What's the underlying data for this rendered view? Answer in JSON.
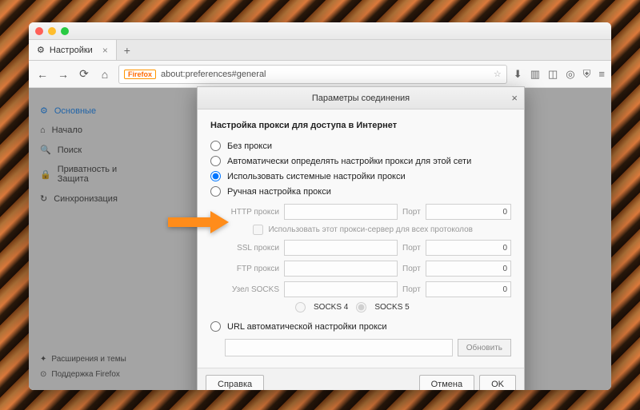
{
  "tab": {
    "title": "Настройки"
  },
  "urlbar": {
    "brand": "Firefox",
    "url": "about:preferences#general"
  },
  "sidebar": {
    "items": [
      {
        "icon": "gear",
        "label": "Основные",
        "active": true
      },
      {
        "icon": "home",
        "label": "Начало"
      },
      {
        "icon": "search",
        "label": "Поиск"
      },
      {
        "icon": "lock",
        "label": "Приватность и Защита"
      },
      {
        "icon": "sync",
        "label": "Синхронизация"
      }
    ],
    "bottom": [
      {
        "icon": "puzzle",
        "label": "Расширения и темы"
      },
      {
        "icon": "help",
        "label": "Поддержка Firefox"
      }
    ]
  },
  "modal": {
    "title": "Параметры соединения",
    "heading": "Настройка прокси для доступа в Интернет",
    "options": {
      "none": "Без прокси",
      "auto": "Автоматически определять настройки прокси для этой сети",
      "system": "Использовать системные настройки прокси",
      "manual": "Ручная настройка прокси",
      "url": "URL автоматической настройки прокси"
    },
    "selected": "system",
    "proxy": {
      "http_label": "HTTP прокси",
      "ssl_label": "SSL прокси",
      "ftp_label": "FTP прокси",
      "socks_label": "Узел SOCKS",
      "port_label": "Порт",
      "port_value": "0",
      "useall_label": "Использовать этот прокси-сервер для всех протоколов",
      "socks4": "SOCKS 4",
      "socks5": "SOCKS 5",
      "socks_selected": "5"
    },
    "refresh": "Обновить",
    "help": "Справка",
    "cancel": "Отмена",
    "ok": "OK"
  }
}
